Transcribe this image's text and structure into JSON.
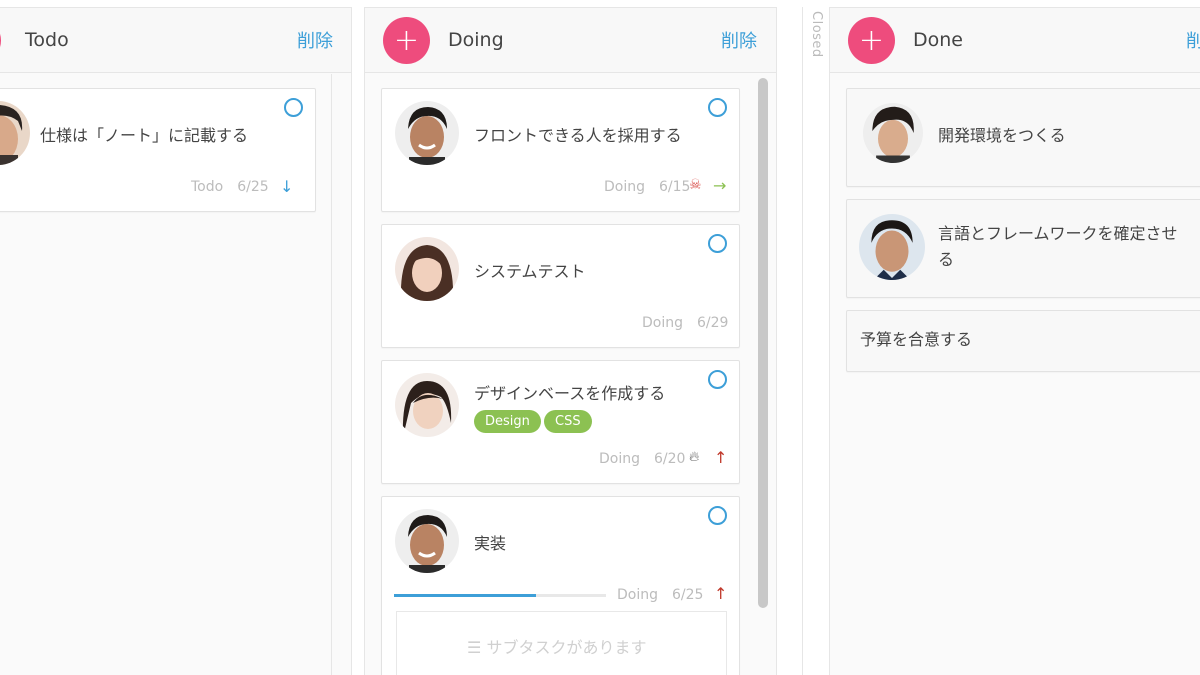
{
  "columns": {
    "todo": {
      "title": "Todo",
      "delete_label": "削除",
      "add_label": "+"
    },
    "doing": {
      "title": "Doing",
      "delete_label": "削除",
      "add_label": "+"
    },
    "done": {
      "title": "Done",
      "delete_label": "削除",
      "add_label": "+"
    }
  },
  "closed_label": "Closed",
  "cards": {
    "todo1": {
      "title": "仕様は「ノート」に記載する",
      "status": "Todo",
      "date": "6/25",
      "priority_icon": "arrow-down-icon"
    },
    "doing1": {
      "title": "フロントできる人を採用する",
      "status": "Doing",
      "date": "6/15",
      "icons": [
        "skull-icon",
        "arrow-right-icon"
      ]
    },
    "doing2": {
      "title": "システムテスト",
      "status": "Doing",
      "date": "6/29"
    },
    "doing3": {
      "title": "デザインベースを作成する",
      "tags": [
        "Design",
        "CSS"
      ],
      "status": "Doing",
      "date": "6/20",
      "icons": [
        "fire-icon",
        "arrow-up-icon"
      ]
    },
    "doing4": {
      "title": "実装",
      "status": "Doing",
      "date": "6/25",
      "progress": 0.67,
      "subtask_text": "サブタスクがあります",
      "icons": [
        "arrow-up-icon"
      ]
    },
    "done1": {
      "title": "開発環境をつくる"
    },
    "done2": {
      "title": "言語とフレームワークを確定させる"
    },
    "done3": {
      "title": "予算を合意する"
    }
  },
  "colors": {
    "accent_pink": "#ee4c7d",
    "accent_blue": "#3d9fd8",
    "tag_green": "#8cc152",
    "priority_red": "#c0392b",
    "priority_green": "#8cc152"
  }
}
